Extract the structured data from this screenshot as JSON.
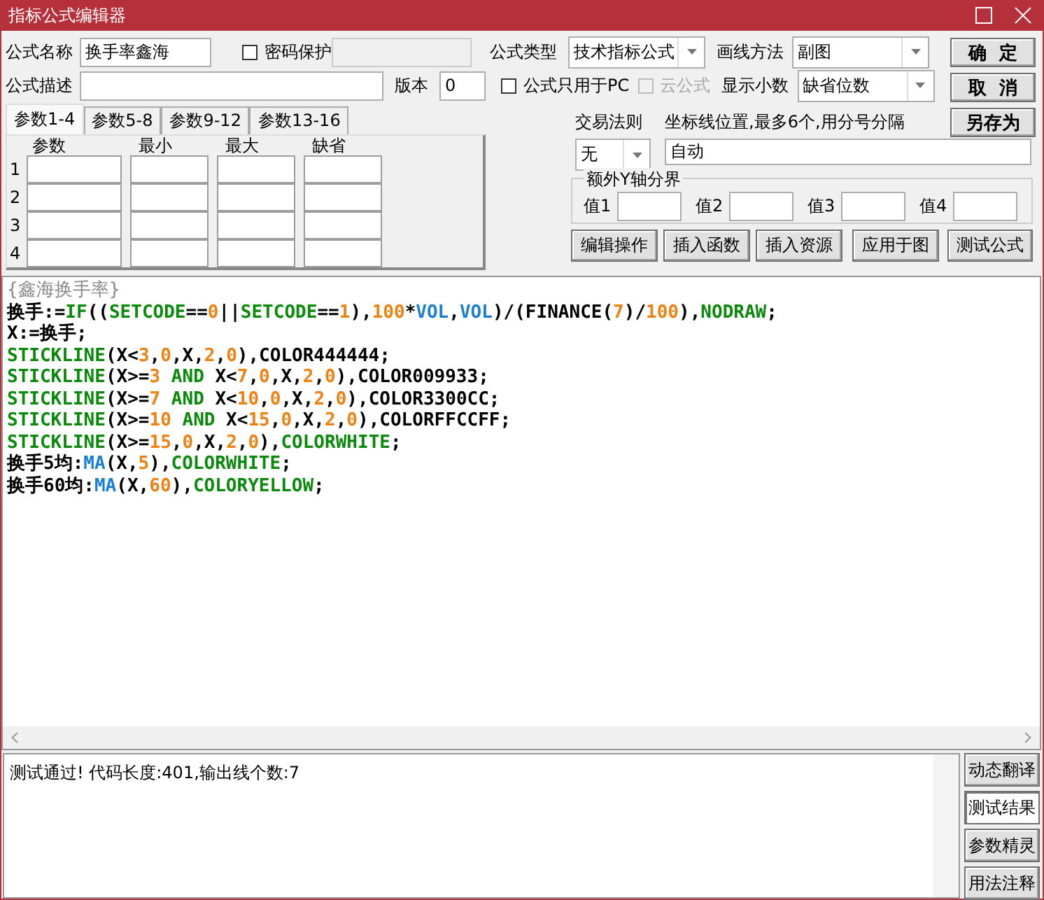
{
  "window": {
    "title": "指标公式编辑器"
  },
  "row1": {
    "name_label": "公式名称",
    "name_value": "换手率鑫海",
    "password": {
      "label": "密码保护",
      "checked": false,
      "disabled": false
    },
    "type_label": "公式类型",
    "type_value": "技术指标公式",
    "draw_label": "画线方法",
    "draw_value": "副图"
  },
  "row2": {
    "desc_label": "公式描述",
    "version_label": "版本",
    "version_value": "0",
    "pc_only": {
      "label": "公式只用于PC",
      "checked": false,
      "disabled": false
    },
    "cloud": {
      "label": "云公式",
      "checked": false,
      "disabled": true
    },
    "decimals_label": "显示小数",
    "decimals_value": "缺省位数"
  },
  "side_buttons": [
    "确  定",
    "取  消",
    "另存为"
  ],
  "tabs": [
    {
      "label": "参数1-4",
      "selected": true
    },
    {
      "label": "参数5-8",
      "selected": false
    },
    {
      "label": "参数9-12",
      "selected": false
    },
    {
      "label": "参数13-16",
      "selected": false
    }
  ],
  "params": {
    "columns": [
      "参数",
      "最小",
      "最大",
      "缺省"
    ],
    "rows": [
      "1",
      "2",
      "3",
      "4"
    ]
  },
  "trade_rule": {
    "label": "交易法则",
    "value": "无"
  },
  "axis_lines": {
    "label": "坐标线位置,最多6个,用分号分隔",
    "value": "自动"
  },
  "y_bounds": {
    "title": "额外Y轴分界",
    "labels": [
      "值1",
      "值2",
      "值3",
      "值4"
    ]
  },
  "action_buttons": [
    "编辑操作",
    "插入函数",
    "插入资源",
    "应用于图",
    "测试公式"
  ],
  "code": [
    [
      {
        "kind": "comment",
        "text": "{鑫海换手率}"
      }
    ],
    [
      {
        "kind": "plain",
        "text": "换手:="
      },
      {
        "kind": "kw",
        "text": "IF"
      },
      {
        "kind": "plain",
        "text": "(("
      },
      {
        "kind": "kw",
        "text": "SETCODE"
      },
      {
        "kind": "plain",
        "text": "=="
      },
      {
        "kind": "num",
        "text": "0"
      },
      {
        "kind": "plain",
        "text": "||"
      },
      {
        "kind": "kw",
        "text": "SETCODE"
      },
      {
        "kind": "plain",
        "text": "=="
      },
      {
        "kind": "num",
        "text": "1"
      },
      {
        "kind": "plain",
        "text": "),"
      },
      {
        "kind": "num",
        "text": "100"
      },
      {
        "kind": "plain",
        "text": "*"
      },
      {
        "kind": "fn",
        "text": "VOL"
      },
      {
        "kind": "plain",
        "text": ","
      },
      {
        "kind": "fn",
        "text": "VOL"
      },
      {
        "kind": "plain",
        "text": ")/(FINANCE("
      },
      {
        "kind": "num",
        "text": "7"
      },
      {
        "kind": "plain",
        "text": ")/"
      },
      {
        "kind": "num",
        "text": "100"
      },
      {
        "kind": "plain",
        "text": "),"
      },
      {
        "kind": "kw",
        "text": "NODRAW"
      },
      {
        "kind": "plain",
        "text": ";"
      }
    ],
    [
      {
        "kind": "plain",
        "text": "X:=换手;"
      }
    ],
    [
      {
        "kind": "kw",
        "text": "STICKLINE"
      },
      {
        "kind": "plain",
        "text": "(X<"
      },
      {
        "kind": "num",
        "text": "3"
      },
      {
        "kind": "plain",
        "text": ","
      },
      {
        "kind": "num",
        "text": "0"
      },
      {
        "kind": "plain",
        "text": ",X,"
      },
      {
        "kind": "num",
        "text": "2"
      },
      {
        "kind": "plain",
        "text": ","
      },
      {
        "kind": "num",
        "text": "0"
      },
      {
        "kind": "plain",
        "text": "),COLOR444444;"
      }
    ],
    [
      {
        "kind": "kw",
        "text": "STICKLINE"
      },
      {
        "kind": "plain",
        "text": "(X>="
      },
      {
        "kind": "num",
        "text": "3"
      },
      {
        "kind": "kw",
        "text": " AND"
      },
      {
        "kind": "plain",
        "text": " X<"
      },
      {
        "kind": "num",
        "text": "7"
      },
      {
        "kind": "plain",
        "text": ","
      },
      {
        "kind": "num",
        "text": "0"
      },
      {
        "kind": "plain",
        "text": ",X,"
      },
      {
        "kind": "num",
        "text": "2"
      },
      {
        "kind": "plain",
        "text": ","
      },
      {
        "kind": "num",
        "text": "0"
      },
      {
        "kind": "plain",
        "text": "),COLOR009933;"
      }
    ],
    [
      {
        "kind": "kw",
        "text": "STICKLINE"
      },
      {
        "kind": "plain",
        "text": "(X>="
      },
      {
        "kind": "num",
        "text": "7"
      },
      {
        "kind": "kw",
        "text": " AND"
      },
      {
        "kind": "plain",
        "text": " X<"
      },
      {
        "kind": "num",
        "text": "10"
      },
      {
        "kind": "plain",
        "text": ","
      },
      {
        "kind": "num",
        "text": "0"
      },
      {
        "kind": "plain",
        "text": ",X,"
      },
      {
        "kind": "num",
        "text": "2"
      },
      {
        "kind": "plain",
        "text": ","
      },
      {
        "kind": "num",
        "text": "0"
      },
      {
        "kind": "plain",
        "text": "),COLOR3300CC;"
      }
    ],
    [
      {
        "kind": "kw",
        "text": "STICKLINE"
      },
      {
        "kind": "plain",
        "text": "(X>="
      },
      {
        "kind": "num",
        "text": "10"
      },
      {
        "kind": "kw",
        "text": " AND"
      },
      {
        "kind": "plain",
        "text": " X<"
      },
      {
        "kind": "num",
        "text": "15"
      },
      {
        "kind": "plain",
        "text": ","
      },
      {
        "kind": "num",
        "text": "0"
      },
      {
        "kind": "plain",
        "text": ",X,"
      },
      {
        "kind": "num",
        "text": "2"
      },
      {
        "kind": "plain",
        "text": ","
      },
      {
        "kind": "num",
        "text": "0"
      },
      {
        "kind": "plain",
        "text": "),COLORFFCCFF;"
      }
    ],
    [
      {
        "kind": "kw",
        "text": "STICKLINE"
      },
      {
        "kind": "plain",
        "text": "(X>="
      },
      {
        "kind": "num",
        "text": "15"
      },
      {
        "kind": "plain",
        "text": ","
      },
      {
        "kind": "num",
        "text": "0"
      },
      {
        "kind": "plain",
        "text": ",X,"
      },
      {
        "kind": "num",
        "text": "2"
      },
      {
        "kind": "plain",
        "text": ","
      },
      {
        "kind": "num",
        "text": "0"
      },
      {
        "kind": "plain",
        "text": "),"
      },
      {
        "kind": "kw",
        "text": "COLORWHITE"
      },
      {
        "kind": "plain",
        "text": ";"
      }
    ],
    [
      {
        "kind": "plain",
        "text": "换手5均:"
      },
      {
        "kind": "fn",
        "text": "MA"
      },
      {
        "kind": "plain",
        "text": "(X,"
      },
      {
        "kind": "num",
        "text": "5"
      },
      {
        "kind": "plain",
        "text": "),"
      },
      {
        "kind": "kw",
        "text": "COLORWHITE"
      },
      {
        "kind": "plain",
        "text": ";"
      }
    ],
    [
      {
        "kind": "plain",
        "text": "换手60均:"
      },
      {
        "kind": "fn",
        "text": "MA"
      },
      {
        "kind": "plain",
        "text": "(X,"
      },
      {
        "kind": "num",
        "text": "60"
      },
      {
        "kind": "plain",
        "text": "),"
      },
      {
        "kind": "kw",
        "text": "COLORYELLOW"
      },
      {
        "kind": "plain",
        "text": ";"
      }
    ]
  ],
  "output": "测试通过! 代码长度:401,输出线个数:7",
  "result_buttons": [
    {
      "label": "动态翻译",
      "selected": false
    },
    {
      "label": "测试结果",
      "selected": true
    },
    {
      "label": "参数精灵",
      "selected": false
    },
    {
      "label": "用法注释",
      "selected": false
    }
  ]
}
